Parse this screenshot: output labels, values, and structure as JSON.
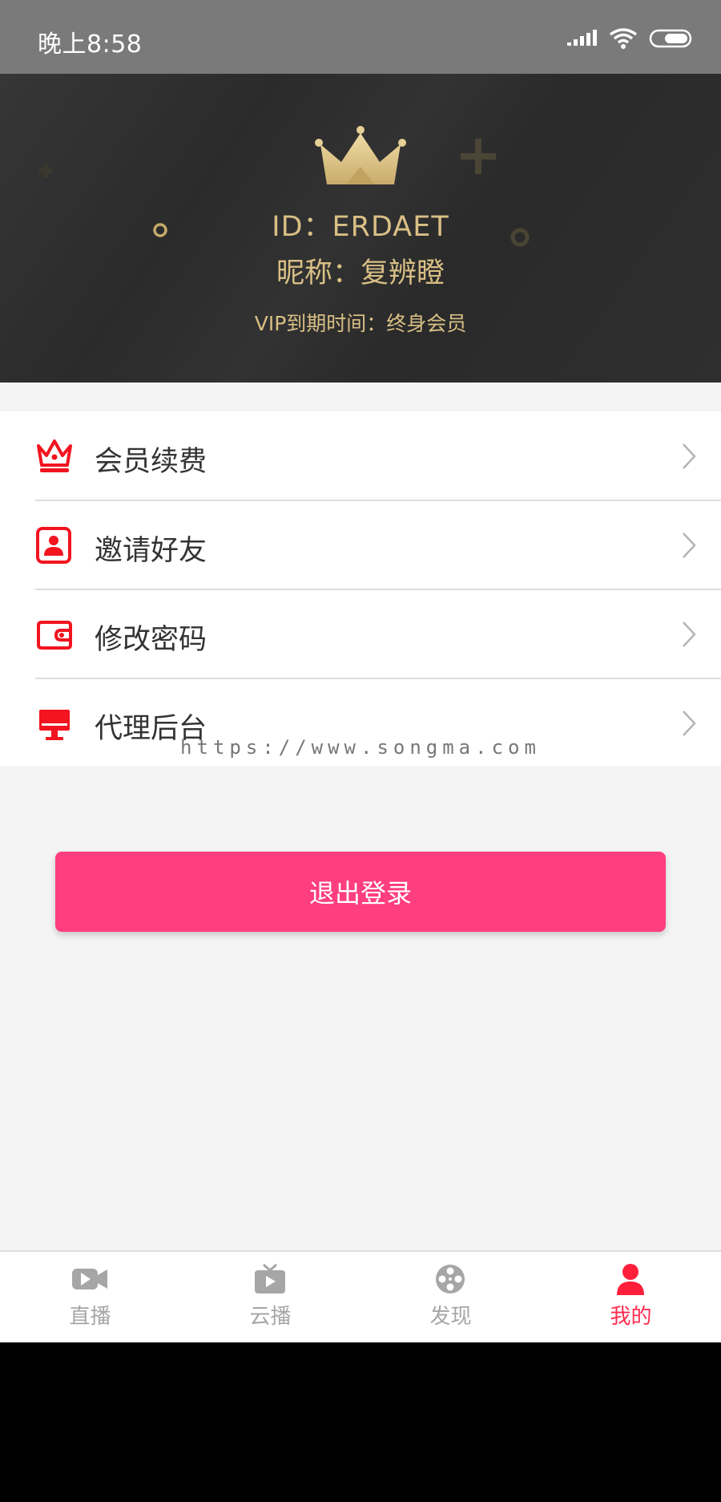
{
  "status_bar": {
    "time": "晚上8:58"
  },
  "profile": {
    "id_text": "ID：ERDAET",
    "nickname_text": "昵称：复辨瞪",
    "vip_text": "VIP到期时间：终身会员"
  },
  "menu": {
    "items": [
      {
        "label": "会员续费",
        "icon": "crown-icon"
      },
      {
        "label": "邀请好友",
        "icon": "contact-card-icon"
      },
      {
        "label": "修改密码",
        "icon": "wallet-icon"
      },
      {
        "label": "代理后台",
        "icon": "monitor-icon"
      }
    ]
  },
  "watermark": "https://www.songma.com",
  "logout_label": "退出登录",
  "tabs": [
    {
      "label": "直播",
      "icon": "video-camera-icon",
      "active": false
    },
    {
      "label": "云播",
      "icon": "tv-icon",
      "active": false
    },
    {
      "label": "发现",
      "icon": "film-reel-icon",
      "active": false
    },
    {
      "label": "我的",
      "icon": "person-icon",
      "active": true
    }
  ],
  "colors": {
    "accent_pink": "#fe3e7e",
    "icon_red": "#f2141f",
    "gold": "#d9bf85",
    "header_dark": "#2e2e2e",
    "tab_active": "#ff2b4f",
    "tab_inactive": "#a6a6a6"
  }
}
